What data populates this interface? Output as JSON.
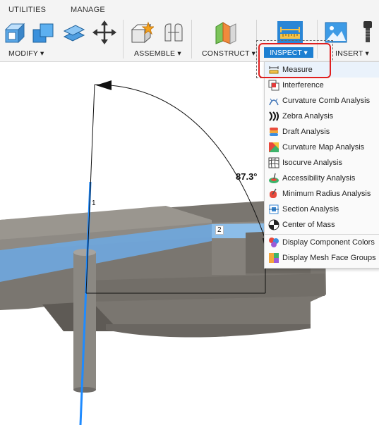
{
  "tabs": {
    "utilities": "UTILITIES",
    "manage": "MANAGE"
  },
  "groups": {
    "modify": "MODIFY ▾",
    "assemble": "ASSEMBLE ▾",
    "construct": "CONSTRUCT ▾",
    "inspect": "INSPECT ▾",
    "insert": "INSERT ▾"
  },
  "menu": {
    "items": [
      {
        "label": "Measure",
        "icon": "ruler-icon"
      },
      {
        "label": "Interference",
        "icon": "interference-icon"
      },
      {
        "label": "Curvature Comb Analysis",
        "icon": "curvature-comb-icon"
      },
      {
        "label": "Zebra Analysis",
        "icon": "zebra-icon"
      },
      {
        "label": "Draft Analysis",
        "icon": "draft-icon"
      },
      {
        "label": "Curvature Map Analysis",
        "icon": "curvature-map-icon"
      },
      {
        "label": "Isocurve Analysis",
        "icon": "isocurve-icon"
      },
      {
        "label": "Accessibility Analysis",
        "icon": "accessibility-icon"
      },
      {
        "label": "Minimum Radius Analysis",
        "icon": "minimum-radius-icon"
      },
      {
        "label": "Section Analysis",
        "icon": "section-icon"
      },
      {
        "label": "Center of Mass",
        "icon": "center-of-mass-icon"
      },
      {
        "label": "Display Component Colors",
        "icon": "component-colors-icon"
      },
      {
        "label": "Display Mesh Face Groups",
        "icon": "mesh-face-groups-icon"
      }
    ]
  },
  "viewport": {
    "angle_label": "87.3°",
    "edge_label_1": "1",
    "edge_label_2": "2"
  },
  "colors": {
    "accent": "#1d7fd1",
    "highlight": "#e02020",
    "body_gray": "#7a7670",
    "selected_blue": "#6fa7dd"
  }
}
